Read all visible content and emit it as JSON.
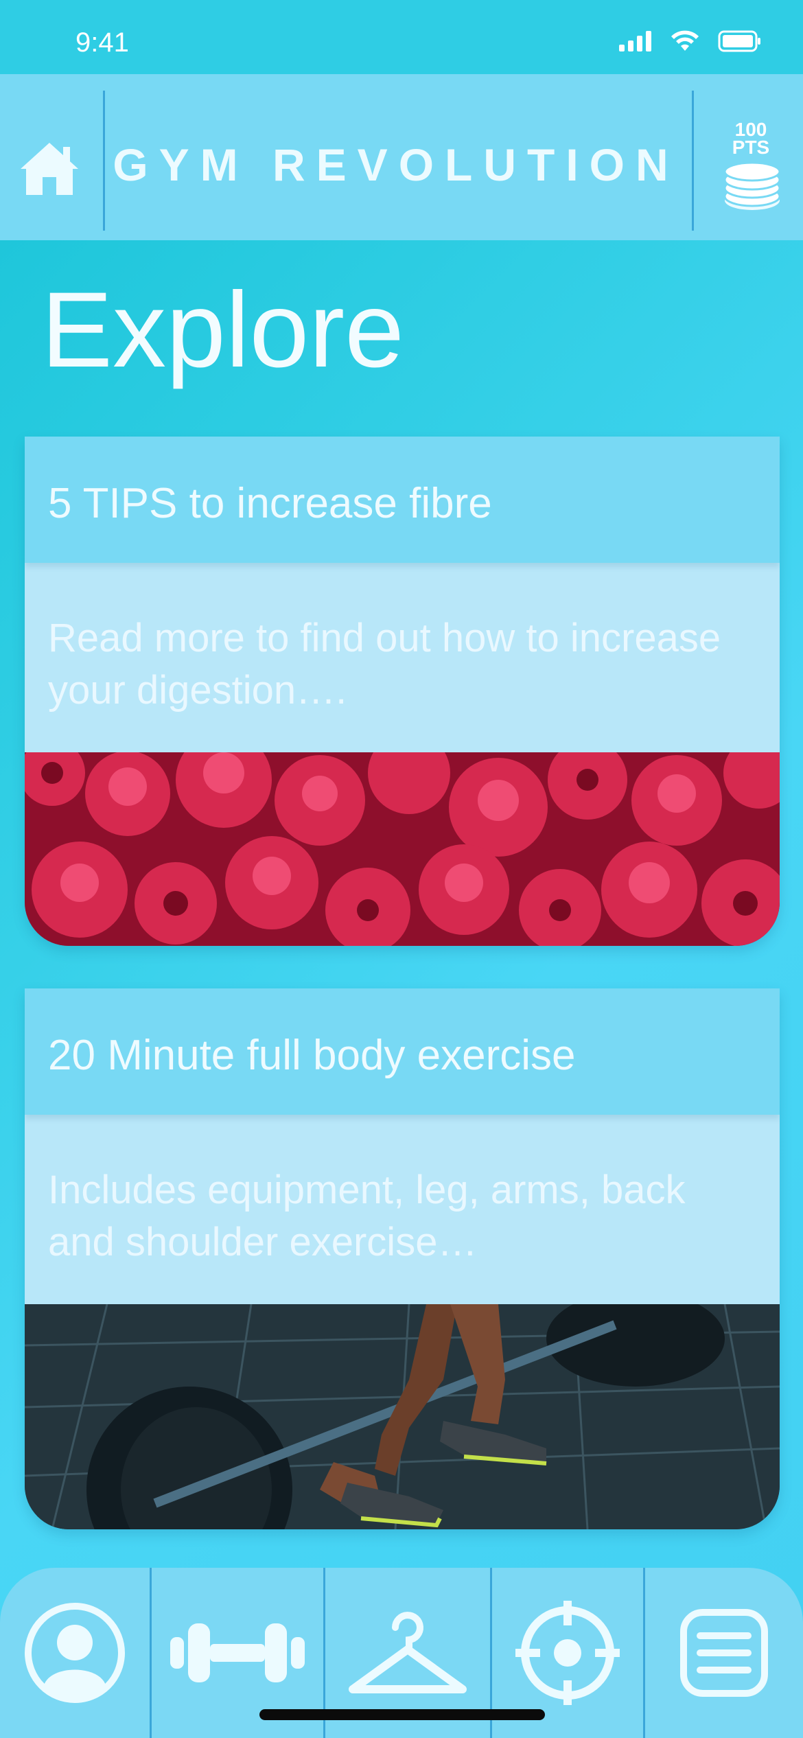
{
  "status_bar": {
    "time": "9:41"
  },
  "header": {
    "title": "GYM REVOLUTION",
    "points_value": "100",
    "points_unit": "PTS",
    "home_icon": "home-icon",
    "points_icon": "coin-stack-icon"
  },
  "page": {
    "title": "Explore"
  },
  "cards": [
    {
      "title": "5 TIPS to increase fibre",
      "description": "Read more to find out how to increase your digestion….",
      "image": "raspberries-photo"
    },
    {
      "title": "20 Minute full body exercise",
      "description": "Includes equipment, leg, arms, back and shoulder exercise…",
      "image": "barbell-deadlift-photo"
    }
  ],
  "bottom_nav": [
    {
      "icon": "profile-icon"
    },
    {
      "icon": "dumbbell-icon"
    },
    {
      "icon": "hanger-icon"
    },
    {
      "icon": "target-icon"
    },
    {
      "icon": "list-icon"
    }
  ],
  "colors": {
    "header": "#78d9f4",
    "divider": "#3aa6d9",
    "card_desc": "#b8e7f9",
    "text": "#ecfbff"
  }
}
